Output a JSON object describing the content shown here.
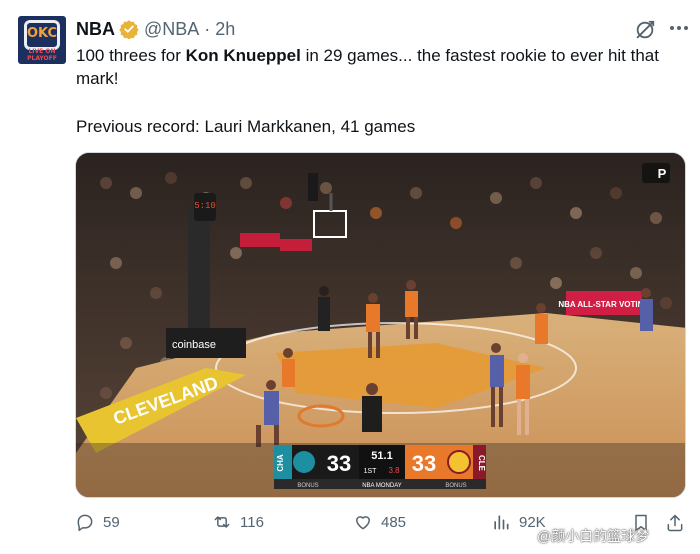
{
  "account": {
    "avatar_text": "OKC",
    "avatar_subtext": "LIVE ON PLAYOFF",
    "name": "NBA",
    "handle": "@NBA",
    "separator": "·",
    "time": "2h"
  },
  "tweet": {
    "text_before": "100 threes for ",
    "text_bold": "Kon Knueppel",
    "text_after": " in 29 games... the fastest rookie to ever hit that mark!",
    "line2": "Previous record: Lauri Markkanen, 41 games"
  },
  "media": {
    "scorebug": {
      "away_team": "CHA",
      "away_score": "33",
      "home_team": "CLE",
      "home_score": "33",
      "clock": "51.1",
      "period": "1ST",
      "shot_clock": "3.8",
      "away_bonus": "BONUS",
      "home_bonus": "BONUS",
      "network": "NBA MONDAY"
    },
    "court_text": "CLEVELAND",
    "sponsor_board": "coinbase",
    "allstar_board": "NBA ALL-STAR VOTING",
    "shot_clock_display": "5:10",
    "broadcast_logo": "P"
  },
  "actions": {
    "replies": "59",
    "reposts": "116",
    "likes": "485",
    "views": "92K"
  },
  "watermark": "@颜小白的篮球梦",
  "colors": {
    "text": "#0f1419",
    "secondary": "#536471",
    "verified": "#e8b339",
    "away_team": "#1d8fa0",
    "home_team": "#e8782a"
  }
}
